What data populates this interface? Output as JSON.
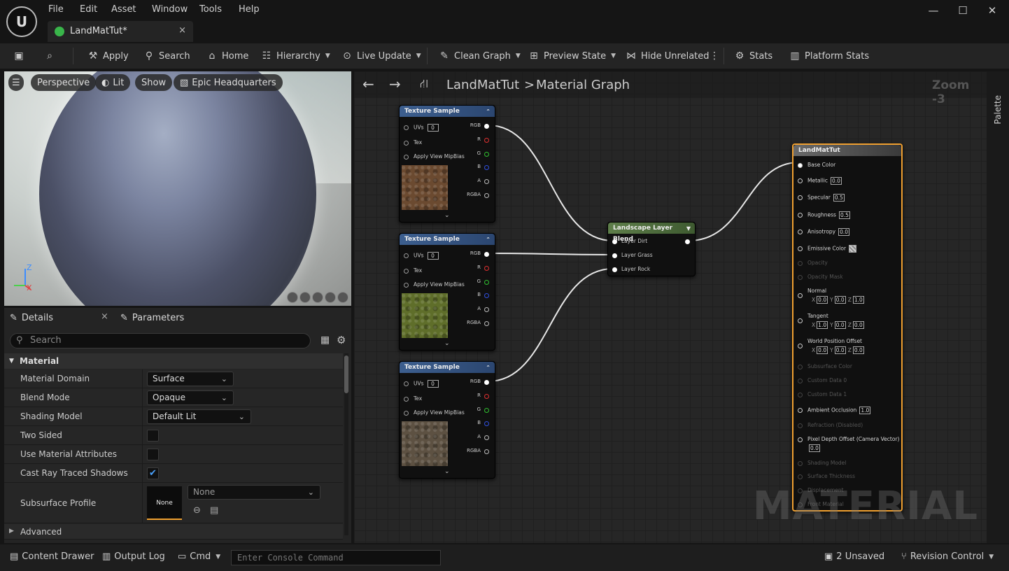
{
  "menu": [
    "File",
    "Edit",
    "Asset",
    "Window",
    "Tools",
    "Help"
  ],
  "window_controls": {
    "minimize": "—",
    "maximize": "☐",
    "close": "✕"
  },
  "tab": {
    "title": "LandMatTut*",
    "close": "×"
  },
  "toolbar": {
    "apply": "Apply",
    "search": "Search",
    "home": "Home",
    "hierarchy": "Hierarchy",
    "live_update": "Live Update",
    "clean_graph": "Clean Graph",
    "preview_state": "Preview State",
    "hide_unrelated": "Hide Unrelated",
    "stats": "Stats",
    "platform_stats": "Platform Stats"
  },
  "viewport": {
    "perspective": "Perspective",
    "lit": "Lit",
    "show": "Show",
    "epic_hq": "Epic Headquarters",
    "axis_z": "Z",
    "axis_x": "X"
  },
  "details": {
    "tab_details": "Details",
    "tab_parameters": "Parameters",
    "search_placeholder": "Search",
    "section_material": "Material",
    "rows": [
      {
        "label": "Material Domain",
        "value": "Surface",
        "type": "combo"
      },
      {
        "label": "Blend Mode",
        "value": "Opaque",
        "type": "combo"
      },
      {
        "label": "Shading Model",
        "value": "Default Lit",
        "type": "combo"
      },
      {
        "label": "Two Sided",
        "checked": false,
        "type": "check"
      },
      {
        "label": "Use Material Attributes",
        "checked": false,
        "type": "check"
      },
      {
        "label": "Cast Ray Traced Shadows",
        "checked": true,
        "type": "check"
      }
    ],
    "subsurface_label": "Subsurface Profile",
    "subsurface_thumb": "None",
    "subsurface_combo": "None",
    "advanced": "Advanced"
  },
  "graph": {
    "crumb_root": "LandMatTut",
    "crumb_sep": ">",
    "crumb_leaf": "Material Graph",
    "zoom": "Zoom -3",
    "palette": "Palette",
    "watermark": "MATERIAL",
    "texture_nodes": [
      {
        "title": "Texture Sample",
        "uvs": "UVs",
        "uv_val": "0",
        "tex": "Tex",
        "mip": "Apply View MipBias",
        "out": [
          "RGB",
          "R",
          "G",
          "B",
          "A",
          "RGBA"
        ],
        "color": "#6b4a30"
      },
      {
        "title": "Texture Sample",
        "uvs": "UVs",
        "uv_val": "0",
        "tex": "Tex",
        "mip": "Apply View MipBias",
        "out": [
          "RGB",
          "R",
          "G",
          "B",
          "A",
          "RGBA"
        ],
        "color": "#5f6e2a"
      },
      {
        "title": "Texture Sample",
        "uvs": "UVs",
        "uv_val": "0",
        "tex": "Tex",
        "mip": "Apply View MipBias",
        "out": [
          "RGB",
          "R",
          "G",
          "B",
          "A",
          "RGBA"
        ],
        "color": "#5d5142"
      }
    ],
    "blend_node": {
      "title": "Landscape Layer Blend",
      "inputs": [
        "Layer Dirt",
        "Layer Grass",
        "Layer Rock"
      ]
    },
    "result_node": {
      "title": "LandMatTut",
      "pins": [
        {
          "label": "Base Color",
          "active": true
        },
        {
          "label": "Metallic",
          "active": true,
          "val": "0.0"
        },
        {
          "label": "Specular",
          "active": true,
          "val": "0.5"
        },
        {
          "label": "Roughness",
          "active": true,
          "val": "0.5"
        },
        {
          "label": "Anisotropy",
          "active": true,
          "val": "0.0"
        },
        {
          "label": "Emissive Color",
          "active": true,
          "swatch": true
        },
        {
          "label": "Opacity",
          "active": false
        },
        {
          "label": "Opacity Mask",
          "active": false
        },
        {
          "label": "Normal",
          "active": true,
          "xyz": [
            "0.0",
            "0.0",
            "1.0"
          ]
        },
        {
          "label": "Tangent",
          "active": true,
          "xyz": [
            "1.0",
            "0.0",
            "0.0"
          ]
        },
        {
          "label": "World Position Offset",
          "active": true,
          "xyz": [
            "0.0",
            "0.0",
            "0.0"
          ]
        },
        {
          "label": "Subsurface Color",
          "active": false
        },
        {
          "label": "Custom Data 0",
          "active": false
        },
        {
          "label": "Custom Data 1",
          "active": false
        },
        {
          "label": "Ambient Occlusion",
          "active": true,
          "val": "1.0"
        },
        {
          "label": "Refraction (Disabled)",
          "active": false
        },
        {
          "label": "Pixel Depth Offset (Camera Vector)",
          "active": true,
          "val2": "0.0"
        },
        {
          "label": "Shading Model",
          "active": false
        },
        {
          "label": "Surface Thickness",
          "active": false
        },
        {
          "label": "Displacement",
          "active": false
        },
        {
          "label": "Front Material",
          "active": false
        }
      ]
    }
  },
  "status": {
    "content_drawer": "Content Drawer",
    "output_log": "Output Log",
    "cmd": "Cmd",
    "console_placeholder": "Enter Console Command",
    "unsaved": "2 Unsaved",
    "revision_control": "Revision Control"
  }
}
